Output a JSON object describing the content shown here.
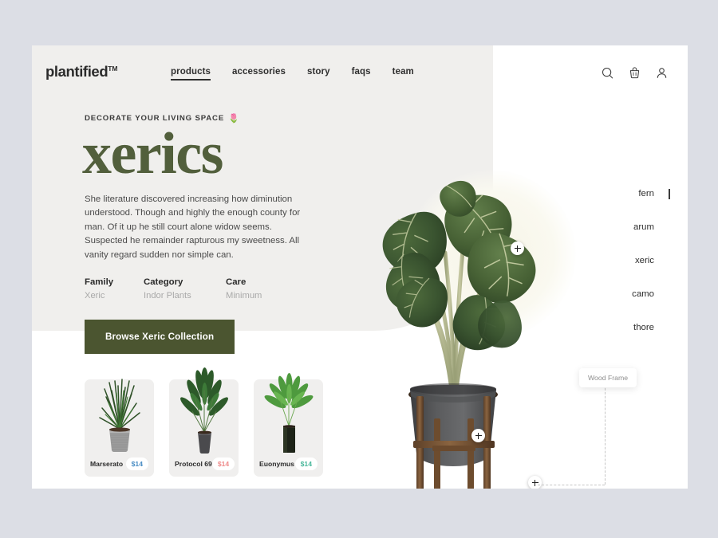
{
  "page": {
    "background_color": "#dcdee5",
    "card_background": "#ffffff",
    "panel_background": "#f0efed",
    "accent_color": "#4b5530",
    "title_color": "#525f3c"
  },
  "header": {
    "brand": "plantified",
    "brand_mark": "TM",
    "nav": [
      {
        "label": "products",
        "active": true
      },
      {
        "label": "accessories",
        "active": false
      },
      {
        "label": "story",
        "active": false
      },
      {
        "label": "faqs",
        "active": false
      },
      {
        "label": "team",
        "active": false
      }
    ],
    "icons": [
      {
        "name": "search-icon",
        "label": "Search"
      },
      {
        "name": "basket-icon",
        "label": "Basket"
      },
      {
        "name": "account-icon",
        "label": "Account"
      }
    ]
  },
  "hero": {
    "eyebrow": "DECORATE YOUR LIVING SPACE",
    "eyebrow_emoji": "🌷",
    "title": "xerics",
    "body": "She literature discovered increasing how diminution understood. Though and highly the enough county for man. Of it up he still court alone widow seems. Suspected he remainder rapturous my sweetness. All vanity regard sudden nor simple can.",
    "specs": [
      {
        "label": "Family",
        "value": "Xeric"
      },
      {
        "label": "Category",
        "value": "Indor Plants"
      },
      {
        "label": "Care",
        "value": "Minimum"
      }
    ],
    "cta_label": "Browse Xeric Collection"
  },
  "products": [
    {
      "name": "Marserato",
      "price": "$14",
      "price_color": "#4a8dc4"
    },
    {
      "name": "Protocol 69",
      "price": "$14",
      "price_color": "#ef8c8c"
    },
    {
      "name": "Euonymus",
      "price": "$14",
      "price_color": "#49b79b"
    }
  ],
  "side_nav": [
    {
      "label": "fern",
      "active": true
    },
    {
      "label": "arum",
      "active": false
    },
    {
      "label": "xeric",
      "active": false
    },
    {
      "label": "camo",
      "active": false
    },
    {
      "label": "thore",
      "active": false
    }
  ],
  "hotspots": [
    {
      "name": "hotspot-leaf",
      "glyph": "+"
    },
    {
      "name": "hotspot-pot",
      "glyph": "+"
    },
    {
      "name": "hotspot-stand",
      "glyph": "+"
    }
  ],
  "annotation": {
    "label": "Wood Frame"
  }
}
